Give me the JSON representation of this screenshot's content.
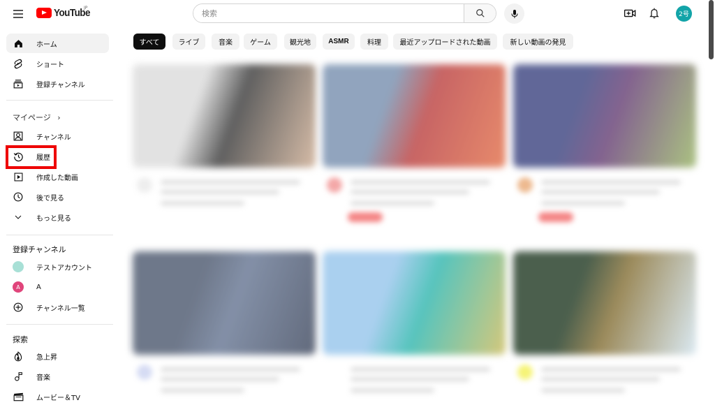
{
  "header": {
    "logo_text": "YouTube",
    "region": "JP",
    "search_placeholder": "検索",
    "search_value": "",
    "avatar_label": "2号",
    "icons": {
      "menu": "hamburger-menu-icon",
      "search": "search-icon",
      "mic": "microphone-icon",
      "create": "create-video-icon",
      "notifications": "bell-icon"
    }
  },
  "sidebar": {
    "main": [
      {
        "label": "ホーム",
        "icon": "home-icon",
        "active": true
      },
      {
        "label": "ショート",
        "icon": "shorts-icon"
      },
      {
        "label": "登録チャンネル",
        "icon": "subscriptions-icon"
      }
    ],
    "mypage": {
      "title": "マイページ",
      "items": [
        {
          "label": "チャンネル",
          "icon": "channel-icon"
        },
        {
          "label": "履歴",
          "icon": "history-icon",
          "highlighted": true
        },
        {
          "label": "作成した動画",
          "icon": "your-videos-icon"
        },
        {
          "label": "後で見る",
          "icon": "watch-later-icon"
        },
        {
          "label": "もっと見る",
          "icon": "chevron-down-icon"
        }
      ]
    },
    "subscriptions": {
      "title": "登録チャンネル",
      "items": [
        {
          "label": "テストアカウント",
          "avatar_color": "#a8e0d6",
          "avatar_text": ""
        },
        {
          "label": "A",
          "avatar_color": "#e0457b",
          "avatar_text": "A"
        },
        {
          "label": "チャンネル一覧",
          "icon": "add-circle-icon"
        }
      ]
    },
    "explore": {
      "title": "探索",
      "items": [
        {
          "label": "急上昇",
          "icon": "trending-icon"
        },
        {
          "label": "音楽",
          "icon": "music-icon"
        },
        {
          "label": "ムービー＆TV",
          "icon": "movies-icon"
        }
      ]
    }
  },
  "chips": [
    {
      "label": "すべて",
      "active": true
    },
    {
      "label": "ライブ"
    },
    {
      "label": "音楽"
    },
    {
      "label": "ゲーム"
    },
    {
      "label": "観光地"
    },
    {
      "label": "ASMR"
    },
    {
      "label": "料理"
    },
    {
      "label": "最近アップロードされた動画"
    },
    {
      "label": "新しい動画の発見"
    }
  ],
  "videos": [
    {
      "thumb_colors": [
        "#d9d9d9",
        "#2b2b2b",
        "#c9a68a"
      ],
      "channel_color": "#e8e8e8",
      "badge": false
    },
    {
      "thumb_colors": [
        "#6c86a8",
        "#b53131",
        "#e0643a"
      ],
      "channel_color": "#f08a8a",
      "badge": true
    },
    {
      "thumb_colors": [
        "#2c3576",
        "#5a2f6a",
        "#8fae58"
      ],
      "channel_color": "#e7a26a",
      "badge": true
    },
    {
      "thumb_colors": [
        "#3e4b63",
        "#5a6b8a",
        "#2d3850"
      ],
      "channel_color": "#c8d0f0",
      "badge": false
    },
    {
      "thumb_colors": [
        "#8ec0ea",
        "#1fb1a8",
        "#c7b64f"
      ],
      "channel_color": "#ffffff",
      "badge": false
    },
    {
      "thumb_colors": [
        "#0f2a12",
        "#7b6425",
        "#cfe3ef"
      ],
      "channel_color": "#f3f04a",
      "badge": false
    }
  ]
}
